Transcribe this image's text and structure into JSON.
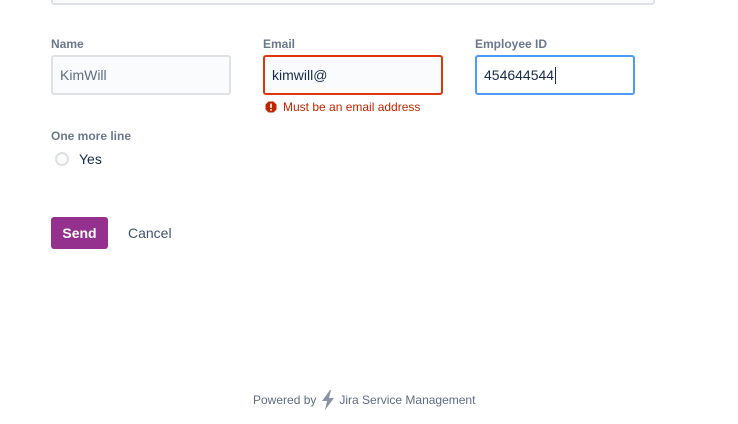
{
  "form": {
    "name_label": "Name",
    "name_value": "KimWill",
    "email_label": "Email",
    "email_value": "kimwill@",
    "email_error": "Must be an email address",
    "employee_id_label": "Employee ID",
    "employee_id_value": "454644544",
    "one_more_line_label": "One more line",
    "radio_yes_label": "Yes"
  },
  "actions": {
    "send_label": "Send",
    "cancel_label": "Cancel"
  },
  "footer": {
    "powered_by": "Powered by",
    "product": "Jira Service Management"
  },
  "colors": {
    "send_button": "#94318e",
    "error": "#de350b",
    "focus": "#4c9aff"
  }
}
